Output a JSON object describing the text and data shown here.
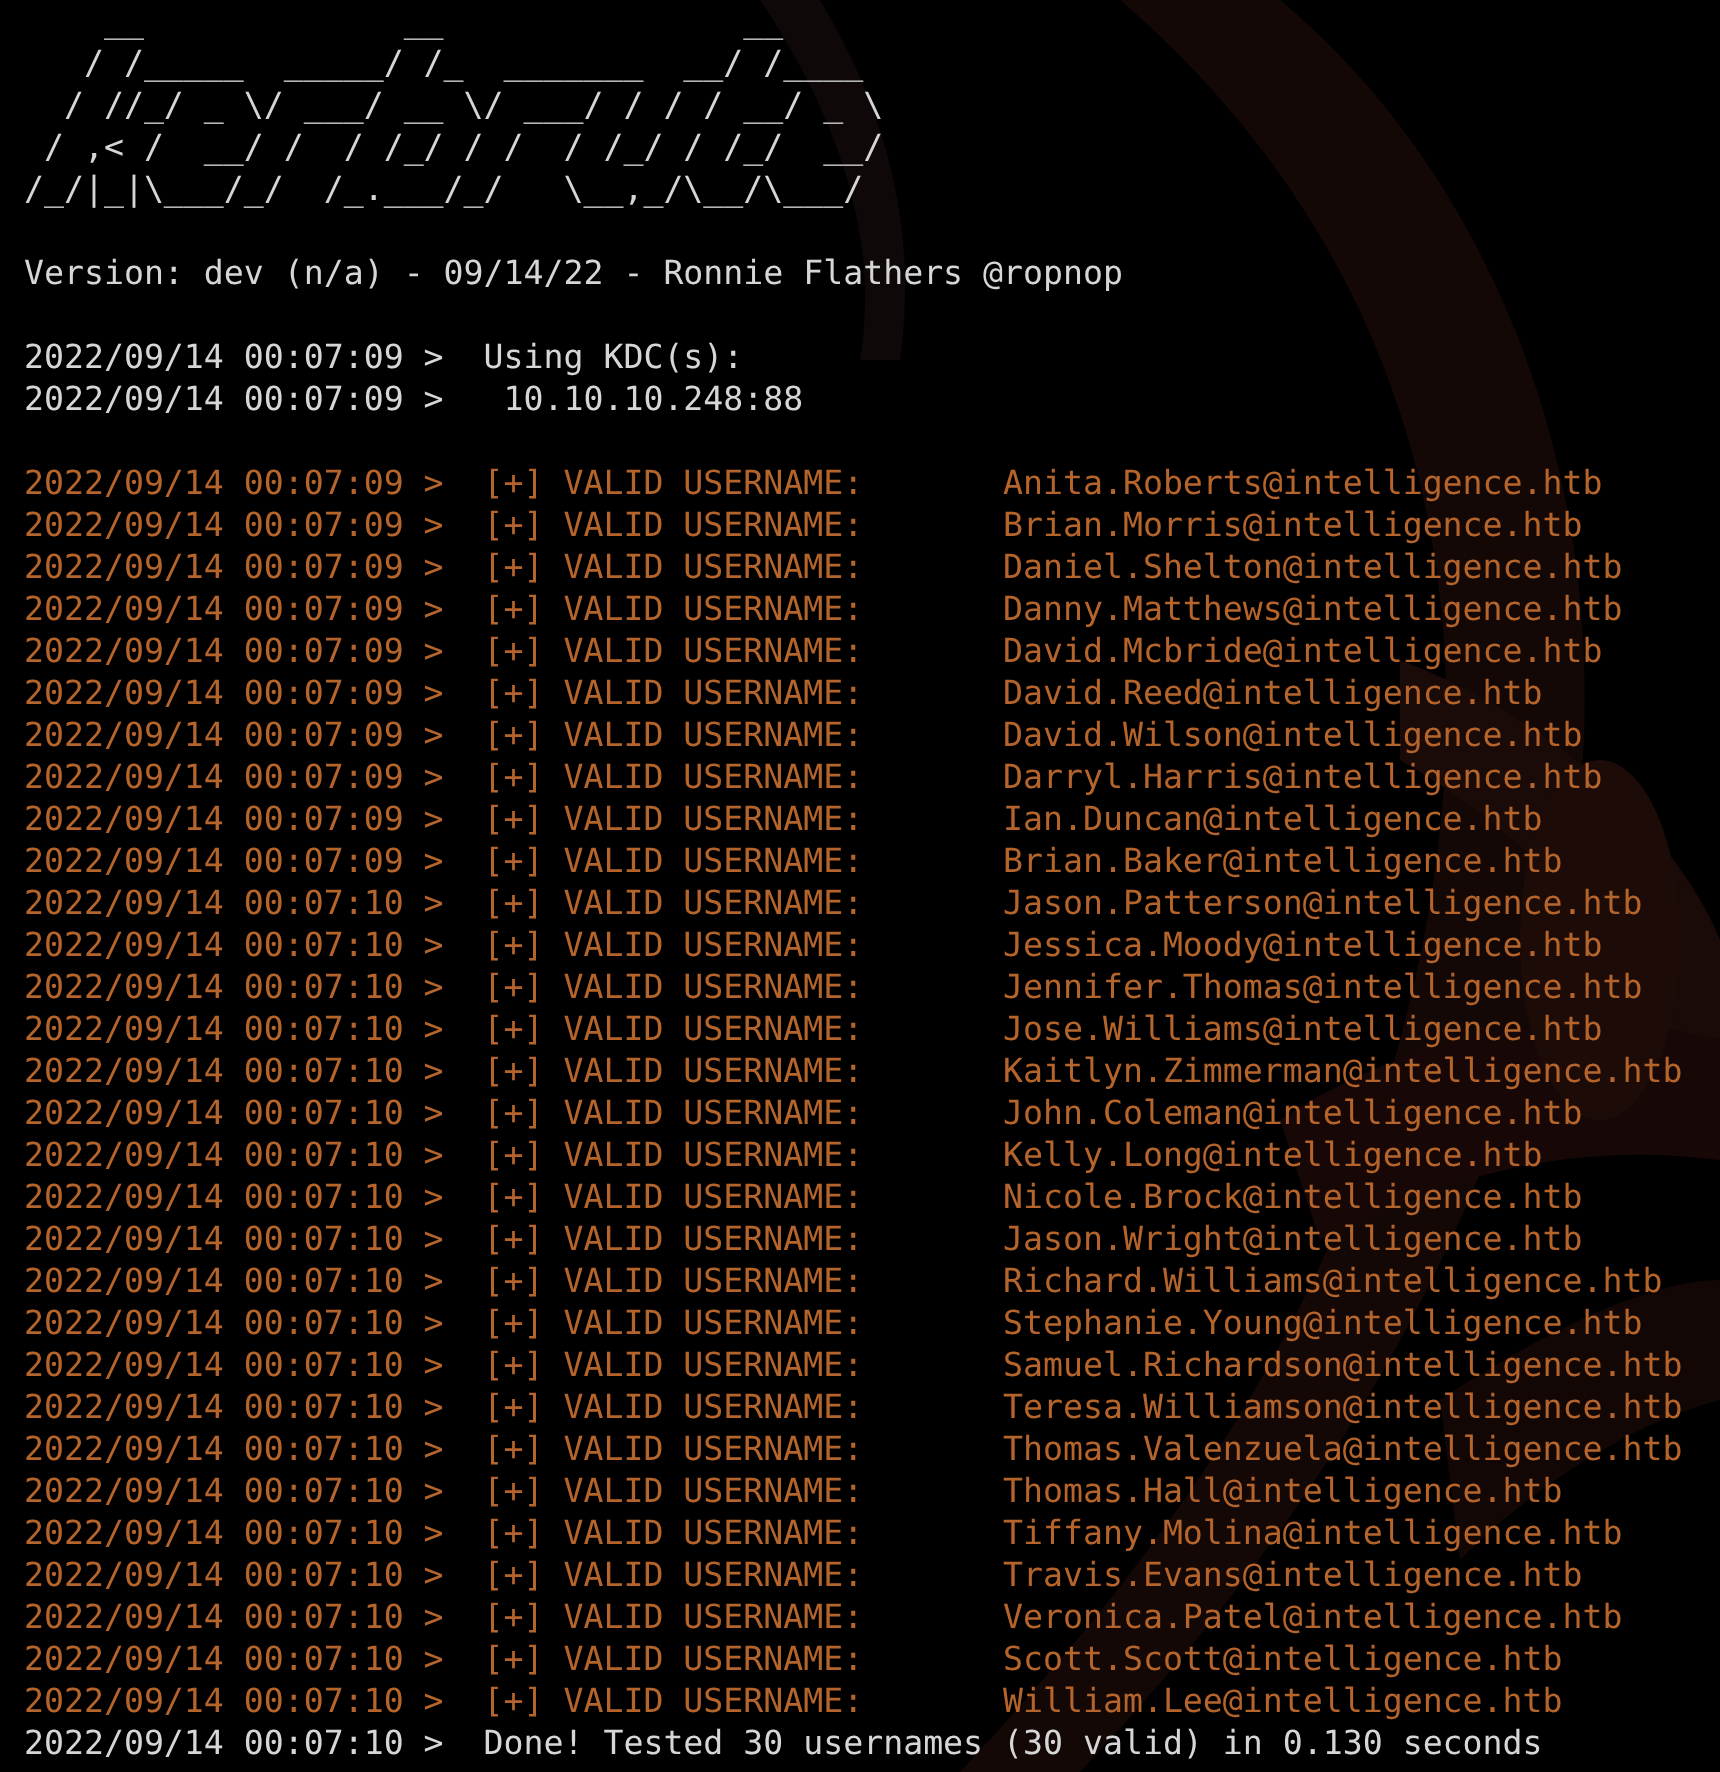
{
  "banner": [
    "    __             __               __",
    "   / /_____  _____/ /_  _______  __/ /____",
    "  / //_/ _ \\/ ___/ __ \\/ ___/ / / / __/ _ \\",
    " / ,< /  __/ /  / /_/ / /  / /_/ / /_/  __/",
    "/_/|_|\\___/_/  /_.___/_/   \\__,_/\\__/\\___/"
  ],
  "version": "Version: dev (n/a) - 09/14/22 - Ronnie Flathers @ropnop",
  "kdc": [
    {
      "time": "2022/09/14 00:07:09 >",
      "message": "  Using KDC(s):"
    },
    {
      "time": "2022/09/14 00:07:09 >",
      "message": "   10.10.10.248:88"
    }
  ],
  "log": [
    {
      "kind": "valid",
      "time": "2022/09/14 00:07:09 >",
      "message": "  [+] VALID USERNAME:       Anita.Roberts@intelligence.htb"
    },
    {
      "kind": "valid",
      "time": "2022/09/14 00:07:09 >",
      "message": "  [+] VALID USERNAME:       Brian.Morris@intelligence.htb"
    },
    {
      "kind": "valid",
      "time": "2022/09/14 00:07:09 >",
      "message": "  [+] VALID USERNAME:       Daniel.Shelton@intelligence.htb"
    },
    {
      "kind": "valid",
      "time": "2022/09/14 00:07:09 >",
      "message": "  [+] VALID USERNAME:       Danny.Matthews@intelligence.htb"
    },
    {
      "kind": "valid",
      "time": "2022/09/14 00:07:09 >",
      "message": "  [+] VALID USERNAME:       David.Mcbride@intelligence.htb"
    },
    {
      "kind": "valid",
      "time": "2022/09/14 00:07:09 >",
      "message": "  [+] VALID USERNAME:       David.Reed@intelligence.htb"
    },
    {
      "kind": "valid",
      "time": "2022/09/14 00:07:09 >",
      "message": "  [+] VALID USERNAME:       David.Wilson@intelligence.htb"
    },
    {
      "kind": "valid",
      "time": "2022/09/14 00:07:09 >",
      "message": "  [+] VALID USERNAME:       Darryl.Harris@intelligence.htb"
    },
    {
      "kind": "valid",
      "time": "2022/09/14 00:07:09 >",
      "message": "  [+] VALID USERNAME:       Ian.Duncan@intelligence.htb"
    },
    {
      "kind": "valid",
      "time": "2022/09/14 00:07:09 >",
      "message": "  [+] VALID USERNAME:       Brian.Baker@intelligence.htb"
    },
    {
      "kind": "valid",
      "time": "2022/09/14 00:07:10 >",
      "message": "  [+] VALID USERNAME:       Jason.Patterson@intelligence.htb"
    },
    {
      "kind": "valid",
      "time": "2022/09/14 00:07:10 >",
      "message": "  [+] VALID USERNAME:       Jessica.Moody@intelligence.htb"
    },
    {
      "kind": "valid",
      "time": "2022/09/14 00:07:10 >",
      "message": "  [+] VALID USERNAME:       Jennifer.Thomas@intelligence.htb"
    },
    {
      "kind": "valid",
      "time": "2022/09/14 00:07:10 >",
      "message": "  [+] VALID USERNAME:       Jose.Williams@intelligence.htb"
    },
    {
      "kind": "valid",
      "time": "2022/09/14 00:07:10 >",
      "message": "  [+] VALID USERNAME:       Kaitlyn.Zimmerman@intelligence.htb"
    },
    {
      "kind": "valid",
      "time": "2022/09/14 00:07:10 >",
      "message": "  [+] VALID USERNAME:       John.Coleman@intelligence.htb"
    },
    {
      "kind": "valid",
      "time": "2022/09/14 00:07:10 >",
      "message": "  [+] VALID USERNAME:       Kelly.Long@intelligence.htb"
    },
    {
      "kind": "valid",
      "time": "2022/09/14 00:07:10 >",
      "message": "  [+] VALID USERNAME:       Nicole.Brock@intelligence.htb"
    },
    {
      "kind": "valid",
      "time": "2022/09/14 00:07:10 >",
      "message": "  [+] VALID USERNAME:       Jason.Wright@intelligence.htb"
    },
    {
      "kind": "valid",
      "time": "2022/09/14 00:07:10 >",
      "message": "  [+] VALID USERNAME:       Richard.Williams@intelligence.htb"
    },
    {
      "kind": "valid",
      "time": "2022/09/14 00:07:10 >",
      "message": "  [+] VALID USERNAME:       Stephanie.Young@intelligence.htb"
    },
    {
      "kind": "valid",
      "time": "2022/09/14 00:07:10 >",
      "message": "  [+] VALID USERNAME:       Samuel.Richardson@intelligence.htb"
    },
    {
      "kind": "valid",
      "time": "2022/09/14 00:07:10 >",
      "message": "  [+] VALID USERNAME:       Teresa.Williamson@intelligence.htb"
    },
    {
      "kind": "valid",
      "time": "2022/09/14 00:07:10 >",
      "message": "  [+] VALID USERNAME:       Thomas.Valenzuela@intelligence.htb"
    },
    {
      "kind": "valid",
      "time": "2022/09/14 00:07:10 >",
      "message": "  [+] VALID USERNAME:       Thomas.Hall@intelligence.htb"
    },
    {
      "kind": "valid",
      "time": "2022/09/14 00:07:10 >",
      "message": "  [+] VALID USERNAME:       Tiffany.Molina@intelligence.htb"
    },
    {
      "kind": "valid",
      "time": "2022/09/14 00:07:10 >",
      "message": "  [+] VALID USERNAME:       Travis.Evans@intelligence.htb"
    },
    {
      "kind": "valid",
      "time": "2022/09/14 00:07:10 >",
      "message": "  [+] VALID USERNAME:       Veronica.Patel@intelligence.htb"
    },
    {
      "kind": "valid",
      "time": "2022/09/14 00:07:10 >",
      "message": "  [+] VALID USERNAME:       Scott.Scott@intelligence.htb"
    },
    {
      "kind": "valid",
      "time": "2022/09/14 00:07:10 >",
      "message": "  [+] VALID USERNAME:       William.Lee@intelligence.htb"
    },
    {
      "kind": "info",
      "time": "2022/09/14 00:07:10 >",
      "message": "  Done! Tested 30 usernames (30 valid) in 0.130 seconds"
    }
  ]
}
